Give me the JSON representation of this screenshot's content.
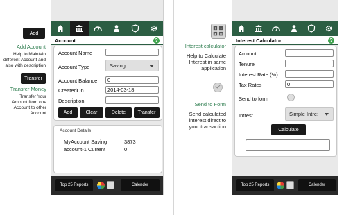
{
  "left": {
    "add_button": "Add",
    "add_title": "Add Account",
    "add_desc": [
      "Help to Maintain",
      "different Account and",
      "also with description"
    ],
    "transfer_button": "Transfer",
    "transfer_title": "Transfer Money",
    "transfer_desc": [
      "Transfer Your",
      "Amount from one",
      "Account to other",
      "Account"
    ]
  },
  "phone1": {
    "title": "Account",
    "fields": {
      "name_label": "Account Name",
      "name_value": "",
      "type_label": "Account Type",
      "type_value": "Saving",
      "balance_label": "Account Balance",
      "balance_value": "0",
      "created_label": "CreatedOn",
      "created_value": "2014-03-18",
      "desc_label": "Description",
      "desc_value": ""
    },
    "buttons": [
      "Add",
      "Clear",
      "Delete",
      "Transfer"
    ],
    "details_title": "Account Details",
    "details_rows": [
      {
        "name": "MyAccount Saving",
        "value": "3873"
      },
      {
        "name": "account-1  Current",
        "value": "0"
      }
    ],
    "bottom": {
      "reports": "Top 25 Reports",
      "calendar": "Calender"
    }
  },
  "middle": {
    "calc_title": "Interest calculator",
    "calc_desc": [
      "Help to Calculate",
      "Interest in same",
      "application"
    ],
    "send_title": "Send to Form",
    "send_desc": [
      "Send calculated",
      "interest direct to",
      "your transaction"
    ]
  },
  "phone2": {
    "title": "Interest Calculator",
    "amount_label": "Amount",
    "tenure_label": "Tenure",
    "rate_label": "Interest Rate (%)",
    "tax_label": "Tax Rates",
    "tax_value": "0",
    "send_label": "Send to form",
    "interest_label": "Intrest",
    "interest_value": "Simple Intre:",
    "calculate_button": "Calculate",
    "result_value": "",
    "bottom": {
      "reports": "Top 25 Reports",
      "calendar": "Calender"
    }
  },
  "colors": {
    "brand_green": "#2c5e43",
    "accent_green": "#2e7d4f",
    "help_green": "#3fa34d"
  },
  "nav_icons": [
    "home-icon",
    "bank-icon",
    "gauge-icon",
    "user-icon",
    "shield-icon",
    "gear-icon"
  ]
}
